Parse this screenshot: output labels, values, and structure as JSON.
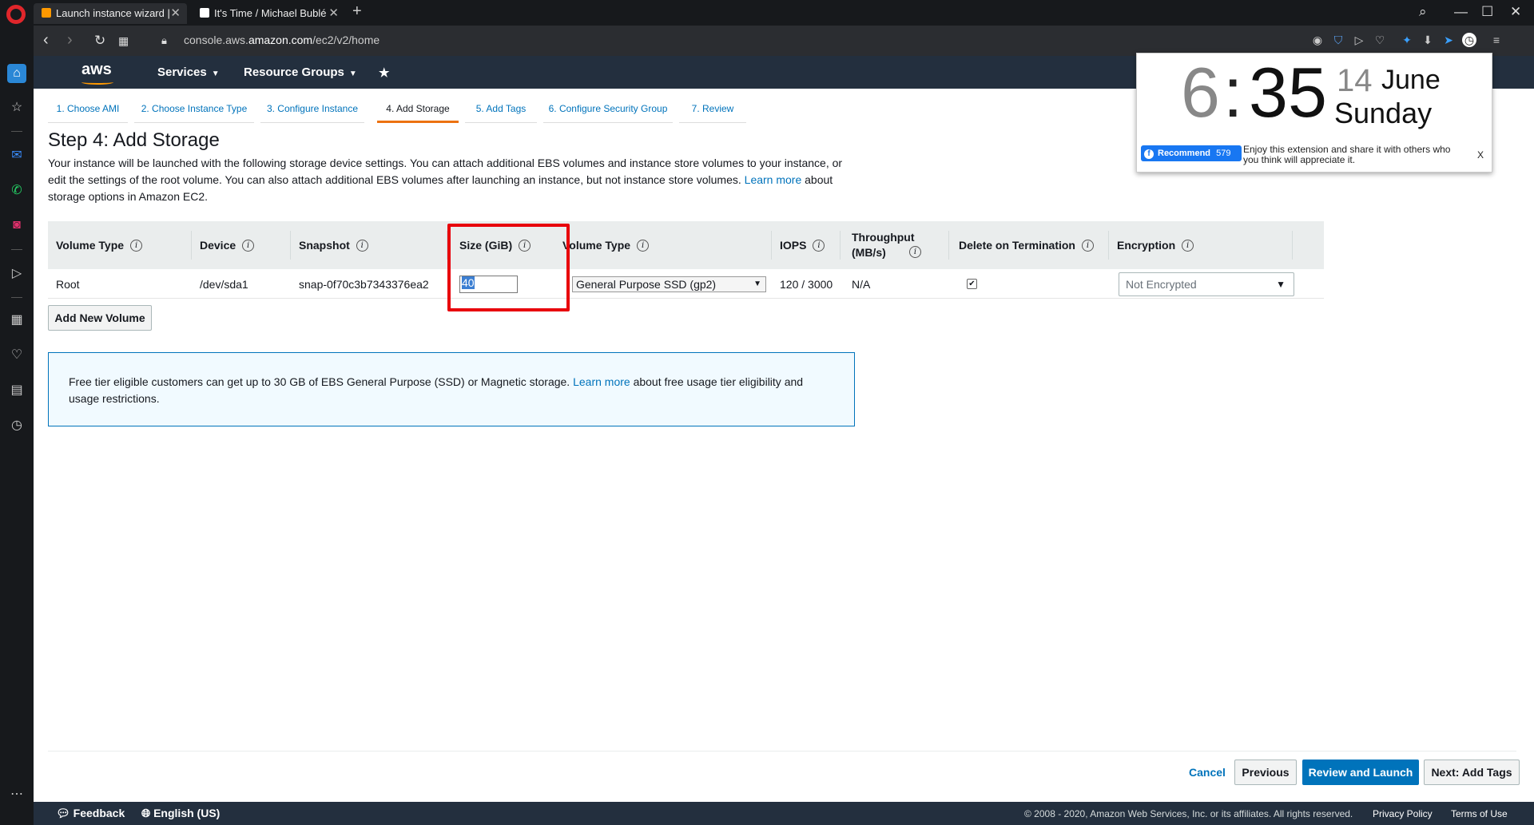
{
  "browser": {
    "tabs": [
      {
        "title": "Launch instance wizard |",
        "close": "✕"
      },
      {
        "title": "It's Time / Michael Bublé",
        "close": "✕"
      }
    ],
    "new_tab": "+",
    "url_prefix": "console.aws.",
    "url_domain": "amazon.com",
    "url_path": "/ec2/v2/home"
  },
  "aws_header": {
    "logo": "aws",
    "services": "Services",
    "resource_groups": "Resource Groups"
  },
  "steps": [
    "1. Choose AMI",
    "2. Choose Instance Type",
    "3. Configure Instance",
    "4. Add Storage",
    "5. Add Tags",
    "6. Configure Security Group",
    "7. Review"
  ],
  "page": {
    "title": "Step 4: Add Storage",
    "desc_1": "Your instance will be launched with the following storage device settings. You can attach additional EBS volumes and instance store volumes to your instance, or edit the settings of the root volume. You can also attach additional EBS volumes after launching an instance, but not instance store volumes.",
    "desc_link": "Learn more",
    "desc_2": "about storage options in Amazon EC2."
  },
  "table": {
    "headers": {
      "volume_type": "Volume Type",
      "device": "Device",
      "snapshot": "Snapshot",
      "size": "Size (GiB)",
      "ebs_type": "Volume Type",
      "iops": "IOPS",
      "throughput": "Throughput (MB/s)",
      "delete_on_term": "Delete on Termination",
      "encryption": "Encryption"
    },
    "row": {
      "volume_type": "Root",
      "device": "/dev/sda1",
      "snapshot": "snap-0f70c3b7343376ea2",
      "size": "40",
      "ebs_type": "General Purpose SSD (gp2)",
      "iops": "120 / 3000",
      "throughput": "N/A",
      "delete_on_term": true,
      "encryption": "Not Encrypted"
    }
  },
  "add_volume": "Add New Volume",
  "info": {
    "text_1": "Free tier eligible customers can get up to 30 GB of EBS General Purpose (SSD) or Magnetic storage.",
    "link": "Learn more",
    "text_2": "about free usage tier eligibility and usage restrictions."
  },
  "actions": {
    "cancel": "Cancel",
    "previous": "Previous",
    "review_launch": "Review and Launch",
    "next": "Next: Add Tags"
  },
  "footer": {
    "feedback": "Feedback",
    "language": "English (US)",
    "copyright": "© 2008 - 2020, Amazon Web Services, Inc. or its affiliates. All rights reserved.",
    "privacy": "Privacy Policy",
    "terms": "Terms of Use"
  },
  "clock": {
    "hour": "6",
    "colon": ":",
    "minute": "35",
    "day": "14",
    "month": "June",
    "weekday": "Sunday",
    "recommend": "Recommend",
    "recommend_count": "579",
    "message": "Enjoy this extension and share it with others who you think will appreciate it.",
    "close": "X"
  },
  "colors": {
    "aws_nav": "#232f3e",
    "link": "#0073bb",
    "active_step": "#ec7211",
    "highlight": "#e8000b"
  }
}
